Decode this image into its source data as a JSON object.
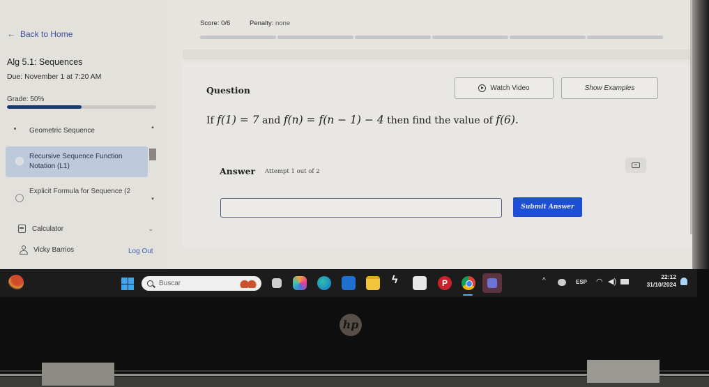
{
  "sidebar": {
    "back_label": "Back to Home",
    "back_icon": "arrow-left-icon",
    "assignment_title": "Alg 5.1: Sequences",
    "due": "Due: November 1 at 7:20 AM",
    "grade_label": "Grade: 50%",
    "grade_percent": 50,
    "topics": [
      {
        "label": "Geometric Sequence",
        "selected": false
      },
      {
        "label": "Recursive Sequence Function Notation (L1)",
        "selected": true
      },
      {
        "label": "Explicit Formula for Sequence (2",
        "selected": false
      }
    ],
    "calculator_label": "Calculator",
    "user_name": "Vicky Barrios",
    "logout_label": "Log Out"
  },
  "header": {
    "score": "Score: 0/6",
    "penalty_label": "Penalty:",
    "penalty_value": "none",
    "question_progress_segments": 6
  },
  "question": {
    "heading": "Question",
    "watch_video_label": "Watch Video",
    "show_examples_label": "Show Examples",
    "text_prefix": "If",
    "math_1": "f(1) = 7",
    "text_and": "and",
    "math_2": "f(n) = f(n − 1) − 4",
    "text_then": "then find the value of",
    "math_3": "f(6)."
  },
  "answer": {
    "heading": "Answer",
    "attempt": "Attempt 1 out of 2",
    "input_value": "",
    "input_placeholder": "",
    "submit_label": "Submit Answer"
  },
  "taskbar": {
    "search_placeholder": "Buscar",
    "apps": [
      "task-view",
      "copilot",
      "edge",
      "outlook",
      "file-explorer",
      "terminal",
      "microsoft-store",
      "pinterest",
      "chrome",
      "teams"
    ],
    "language": "ESP",
    "time": "22:12",
    "date": "31/10/2024"
  },
  "device": {
    "brand": "hp"
  },
  "colors": {
    "accent": "#1d4fd6",
    "link": "#3b4f9a",
    "grade_fill": "#1c3a72",
    "selected_topic": "#bccadb"
  }
}
